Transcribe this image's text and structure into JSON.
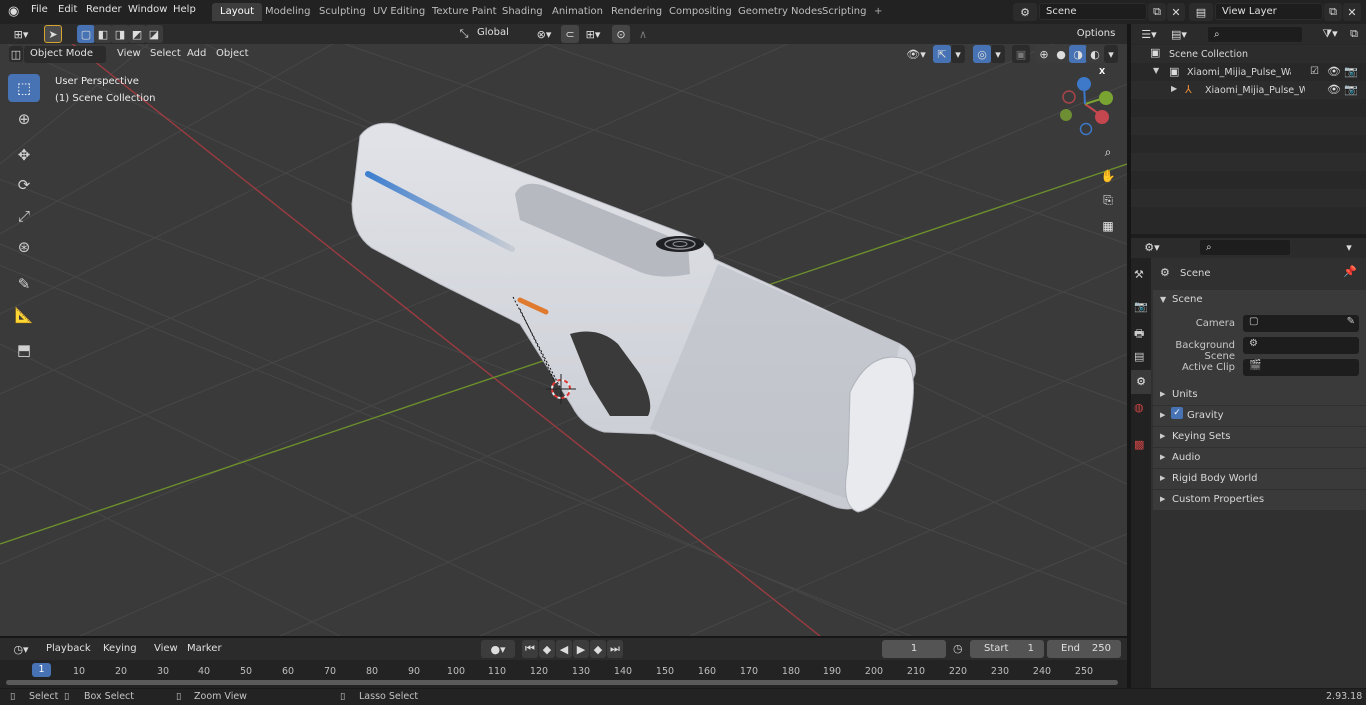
{
  "topbar": {
    "menus": [
      "File",
      "Edit",
      "Render",
      "Window",
      "Help"
    ],
    "workspaces": [
      "Layout",
      "Modeling",
      "Sculpting",
      "UV Editing",
      "Texture Paint",
      "Shading",
      "Animation",
      "Rendering",
      "Compositing",
      "Geometry Nodes",
      "Scripting"
    ],
    "active_workspace": "Layout",
    "add_workspace": "+",
    "scene_name": "Scene",
    "view_layer": "View Layer"
  },
  "viewport": {
    "mode": "Object Mode",
    "menus": [
      "View",
      "Select",
      "Add",
      "Object"
    ],
    "transform_orientation": "Global",
    "options_label": "Options",
    "overlay_title": "User Perspective",
    "overlay_subtitle": "(1) Scene Collection",
    "gizmo": {
      "x": "X",
      "y": "Y",
      "z": "Z"
    }
  },
  "outliner": {
    "root": "Scene Collection",
    "collection": "Xiaomi_Mijia_Pulse_Water_Gu",
    "object": "Xiaomi_Mijia_Pulse_Wate"
  },
  "properties": {
    "context": "Scene",
    "panel": "Scene",
    "camera_label": "Camera",
    "background_label": "Background Scene",
    "clip_label": "Active Clip",
    "sections": [
      "Units",
      "Gravity",
      "Keying Sets",
      "Audio",
      "Rigid Body World",
      "Custom Properties"
    ],
    "gravity_checked": true
  },
  "timeline": {
    "menus": [
      "Playback",
      "Keying",
      "View",
      "Marker"
    ],
    "current_frame": "1",
    "start_label": "Start",
    "start": "1",
    "end_label": "End",
    "end": "250",
    "ticks": [
      "1",
      "10",
      "20",
      "30",
      "40",
      "50",
      "60",
      "70",
      "80",
      "90",
      "100",
      "110",
      "120",
      "130",
      "140",
      "150",
      "160",
      "170",
      "180",
      "190",
      "200",
      "210",
      "220",
      "230",
      "240",
      "250"
    ]
  },
  "statusbar": {
    "select": "Select",
    "box_select": "Box Select",
    "zoom_view": "Zoom View",
    "lasso_select": "Lasso Select",
    "version": "2.93.18"
  },
  "colors": {
    "accent": "#4772b3",
    "x_axis": "#c4464f",
    "y_axis": "#7aa431",
    "z_axis": "#3d78c9"
  }
}
